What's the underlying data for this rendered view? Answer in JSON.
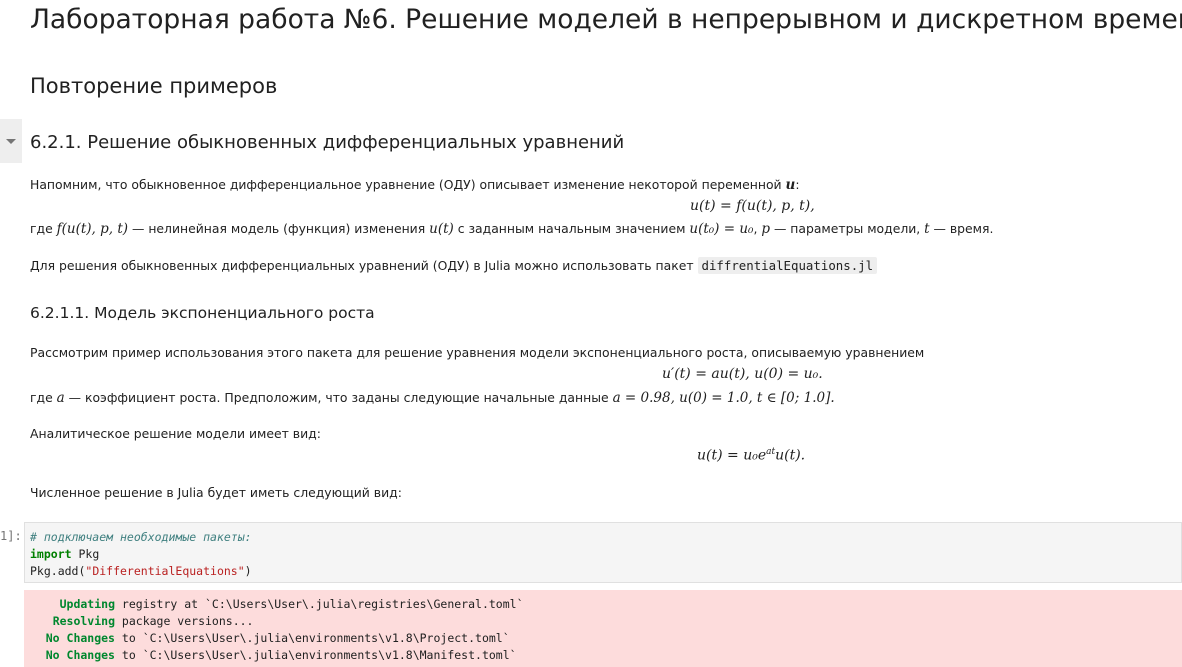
{
  "notebook": {
    "title": "Лабораторная работа №6. Решение моделей в непрерывном и дискретном времени",
    "section": "Повторение примеров",
    "subsection": "6.2.1. Решение обыкновенных дифференциальных уравнений",
    "subsubsection": "6.2.1.1. Модель экспоненциального роста"
  },
  "paragraphs": {
    "p1_text": "Напомним, что обыкновенное дифференциальное уравнение (ОДУ) описывает изменение некоторой переменной ",
    "p1_var": "u",
    "p1_end": ":",
    "eq1": "u(t) = f(u(t), p, t),",
    "p2_a": "где ",
    "p2_f": "f(u(t), p, t)",
    "p2_b": " — нелинейная модель (функция) изменения ",
    "p2_u": "u(t)",
    "p2_c": " с заданным начальным значением ",
    "p2_u0": "u(t₀) = u₀",
    "p2_d": ", ",
    "p2_p": "p",
    "p2_e": " — параметры модели, ",
    "p2_t": "t",
    "p2_f2": " — время.",
    "p3_text": "Для решения обыкновенных дифференциальных уравнений (ОДУ) в Julia можно использовать пакет ",
    "p3_code": "diffrentialEquations.jl",
    "p4_text": "Рассмотрим пример использования этого пакета для решение уравнения модели экспоненциального роста, описываемую уравнением",
    "eq2": "u′(t) = au(t),     u(0) = u₀.",
    "p5_a": "где ",
    "p5_a_var": "a",
    "p5_b": " — коэффициент роста. Предположим, что заданы следующие начальные данные ",
    "p5_vals": "a = 0.98, u(0) = 1.0, t ∈ [0; 1.0].",
    "p6_text": "Аналитическое решение модели имеет вид:",
    "eq3_a": "u(t) = u₀e",
    "eq3_sup": "at",
    "eq3_b": "u(t).",
    "p7_text": "Численное решение в Julia будет иметь следующий вид:"
  },
  "code_cell": {
    "prompt": "1]:",
    "comment": "# подключаем необходимые пакеты:",
    "kw_import": "import",
    "import_rest": " Pkg",
    "line3_a": "Pkg.add(",
    "line3_str": "\"DifferentialEquations\"",
    "line3_b": ")"
  },
  "output": {
    "lines": [
      {
        "status": "Updating",
        "text": " registry at `C:\\Users\\User\\.julia\\registries\\General.toml`"
      },
      {
        "status": "Resolving",
        "text": " package versions..."
      },
      {
        "status": "No Changes",
        "text": " to `C:\\Users\\User\\.julia\\environments\\v1.8\\Project.toml`"
      },
      {
        "status": "No Changes",
        "text": " to `C:\\Users\\User\\.julia\\environments\\v1.8\\Manifest.toml`"
      }
    ]
  },
  "colors": {
    "output_bg": "#fddcdc",
    "status_green": "#00872e",
    "keyword": "#008000",
    "string": "#ba2121",
    "comment": "#408080"
  },
  "icons": {
    "collapser": "chevron-down-icon"
  }
}
